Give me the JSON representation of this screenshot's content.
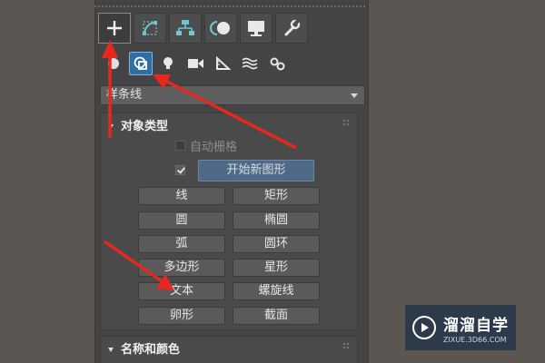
{
  "create_panel": {
    "tabs": [
      {
        "name": "create",
        "icon": "plus-icon",
        "active": true
      },
      {
        "name": "modify",
        "icon": "modify-curve-icon",
        "active": false
      },
      {
        "name": "hierarchy",
        "icon": "hierarchy-icon",
        "active": false
      },
      {
        "name": "motion",
        "icon": "motion-icon",
        "active": false
      },
      {
        "name": "display",
        "icon": "monitor-icon",
        "active": false
      },
      {
        "name": "utilities",
        "icon": "wrench-icon",
        "active": false
      }
    ],
    "categories": [
      {
        "name": "geometry",
        "icon": "geometry-sphere-icon",
        "active": false
      },
      {
        "name": "shapes",
        "icon": "shapes-icon",
        "active": true
      },
      {
        "name": "lights",
        "icon": "lightbulb-icon",
        "active": false
      },
      {
        "name": "cameras",
        "icon": "camera-icon",
        "active": false
      },
      {
        "name": "helpers",
        "icon": "ruler-triangle-icon",
        "active": false
      },
      {
        "name": "space-warps",
        "icon": "waves-icon",
        "active": false
      },
      {
        "name": "systems",
        "icon": "gears-icon",
        "active": false
      }
    ],
    "dropdown": {
      "selected": "样条线"
    },
    "object_type": {
      "title": "对象类型",
      "autogrid_label": "自动栅格",
      "autogrid_checked": false,
      "start_new_shape_checked": true,
      "start_new_shape_label": "开始新图形",
      "buttons": [
        "线",
        "矩形",
        "圆",
        "椭圆",
        "弧",
        "圆环",
        "多边形",
        "星形",
        "文本",
        "螺旋线",
        "卵形",
        "截面"
      ]
    },
    "name_color": {
      "title": "名称和颜色"
    }
  },
  "watermark": {
    "name": "溜溜自学",
    "url": "ZIXUE.3D66.COM"
  },
  "colors": {
    "panel": "#444444",
    "accent_blue": "#2f6ea3",
    "arrow_red": "#e8271f"
  }
}
